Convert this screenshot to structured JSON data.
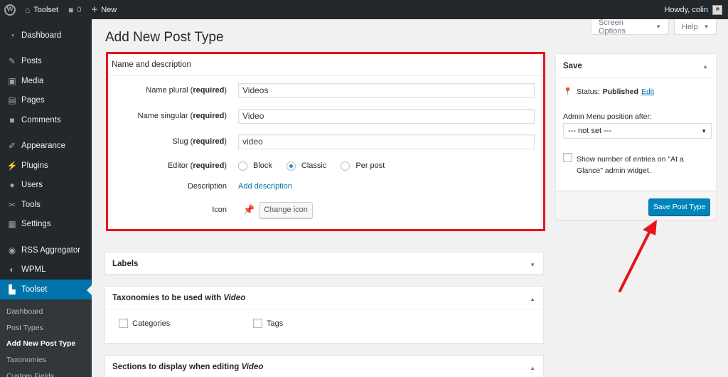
{
  "adminbar": {
    "site_name": "Toolset",
    "comments_count": "0",
    "new_label": "New",
    "howdy": "Howdy, colin"
  },
  "sidebar": {
    "items": [
      {
        "label": "Dashboard",
        "icon": "dashboard-icon"
      },
      {
        "label": "Posts",
        "icon": "pushpin-icon"
      },
      {
        "label": "Media",
        "icon": "media-icon"
      },
      {
        "label": "Pages",
        "icon": "pages-icon"
      },
      {
        "label": "Comments",
        "icon": "comment-icon"
      },
      {
        "label": "Appearance",
        "icon": "paintbrush-icon"
      },
      {
        "label": "Plugins",
        "icon": "plugin-icon"
      },
      {
        "label": "Users",
        "icon": "user-icon"
      },
      {
        "label": "Tools",
        "icon": "wrench-icon"
      },
      {
        "label": "Settings",
        "icon": "settings-icon"
      },
      {
        "label": "RSS Aggregator",
        "icon": "rss-icon"
      },
      {
        "label": "WPML",
        "icon": "wpml-icon"
      },
      {
        "label": "Toolset",
        "icon": "toolset-icon"
      }
    ],
    "submenu": [
      "Dashboard",
      "Post Types",
      "Add New Post Type",
      "Taxonomies",
      "Custom Fields"
    ]
  },
  "header": {
    "screen_options": "Screen Options",
    "help": "Help",
    "title": "Add New Post Type"
  },
  "name_desc": {
    "title": "Name and description",
    "required": "required",
    "name_plural_label": "Name plural",
    "name_plural_value": "Videos",
    "name_singular_label": "Name singular",
    "name_singular_value": "Video",
    "slug_label": "Slug",
    "slug_value": "video",
    "editor_label": "Editor",
    "editor_options": [
      "Block",
      "Classic",
      "Per post"
    ],
    "editor_selected": "Classic",
    "description_label": "Description",
    "add_description": "Add description",
    "icon_label": "Icon",
    "change_icon": "Change icon"
  },
  "labels_box": {
    "title": "Labels"
  },
  "taxonomies_box": {
    "title_prefix": "Taxonomies to be used with",
    "title_em": "Video",
    "options": [
      "Categories",
      "Tags"
    ]
  },
  "sections_box": {
    "title_prefix": "Sections to display when editing",
    "title_em": "Video"
  },
  "save_box": {
    "title": "Save",
    "status_label": "Status:",
    "status_value": "Published",
    "edit": "Edit",
    "menu_position_label": "Admin Menu position after:",
    "menu_position_value": "--- not set ---",
    "show_entries_label": "Show number of entries on \"At a Glance\" admin widget.",
    "save_button": "Save Post Type"
  },
  "colors": {
    "highlight": "#e8131b",
    "primary": "#0085ba",
    "sidebar": "#23282d",
    "active": "#0073aa"
  }
}
